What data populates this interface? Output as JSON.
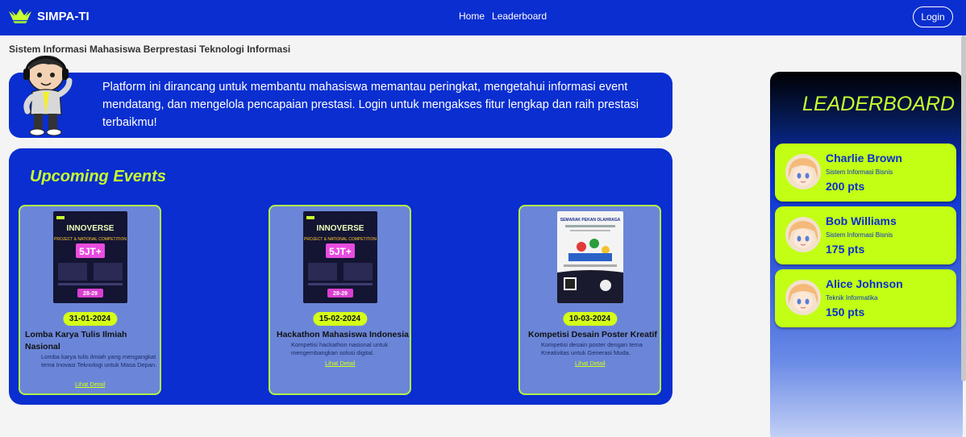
{
  "header": {
    "brand": "SIMPA-TI",
    "nav": [
      "Home",
      "Leaderboard"
    ],
    "login_label": "Login"
  },
  "subtitle": "Sistem Informasi Mahasiswa Berprestasi Teknologi Informasi",
  "intro": {
    "text": "Platform ini dirancang untuk membantu mahasiswa memantau peringkat, mengetahui informasi event mendatang, dan mengelola pencapaian prestasi. Login untuk mengakses fitur lengkap dan raih prestasi terbaikmu!"
  },
  "events": {
    "title": "Upcoming Events",
    "items": [
      {
        "date": "31-01-2024",
        "title": "Lomba Karya Tulis Ilmiah Nasional",
        "desc": "Lomba karya tulis ilmiah yang mengangkat tema Inovasi Teknologi untuk Masa Depan.",
        "link": "Lihat Detail",
        "poster": {
          "heading": "INNOVERSE",
          "sub": "PROJECT & NATIONAL COMPETITION",
          "prize": "5JT+",
          "dates": "28-29"
        }
      },
      {
        "date": "15-02-2024",
        "title": "Hackathon Mahasiswa Indonesia",
        "desc": "Kompetisi hackathon nasional untuk mengembangkan solusi digital.",
        "link": "Lihat Detail",
        "poster": {
          "heading": "INNOVERSE",
          "sub": "PROJECT & NATIONAL COMPETITION",
          "prize": "5JT+",
          "dates": "28-29"
        }
      },
      {
        "date": "10-03-2024",
        "title": "Kompetisi Desain Poster Kreatif",
        "desc": "Kompetisi desain poster dengan tema Kreativitas untuk Generasi Muda.",
        "link": "Lihat Detail",
        "poster": {
          "heading": "SEMARAK PEKAN OLAHRAGA"
        }
      }
    ]
  },
  "leaderboard": {
    "title": "LEADERBOARD",
    "entries": [
      {
        "name": "Charlie Brown",
        "major": "Sistem Informasi Bisnis",
        "points": "200 pts"
      },
      {
        "name": "Bob Williams",
        "major": "Sistem Informasi Bisnis",
        "points": "175 pts"
      },
      {
        "name": "Alice Johnson",
        "major": "Teknik Informatika",
        "points": "150 pts"
      }
    ]
  },
  "colors": {
    "primary": "#0a2ed0",
    "accent": "#c6ff2e",
    "card": "#6b86d8",
    "badge": "#d4ff18"
  },
  "icons": [
    "logo-icon",
    "mascot-icon",
    "avatar-icon"
  ]
}
